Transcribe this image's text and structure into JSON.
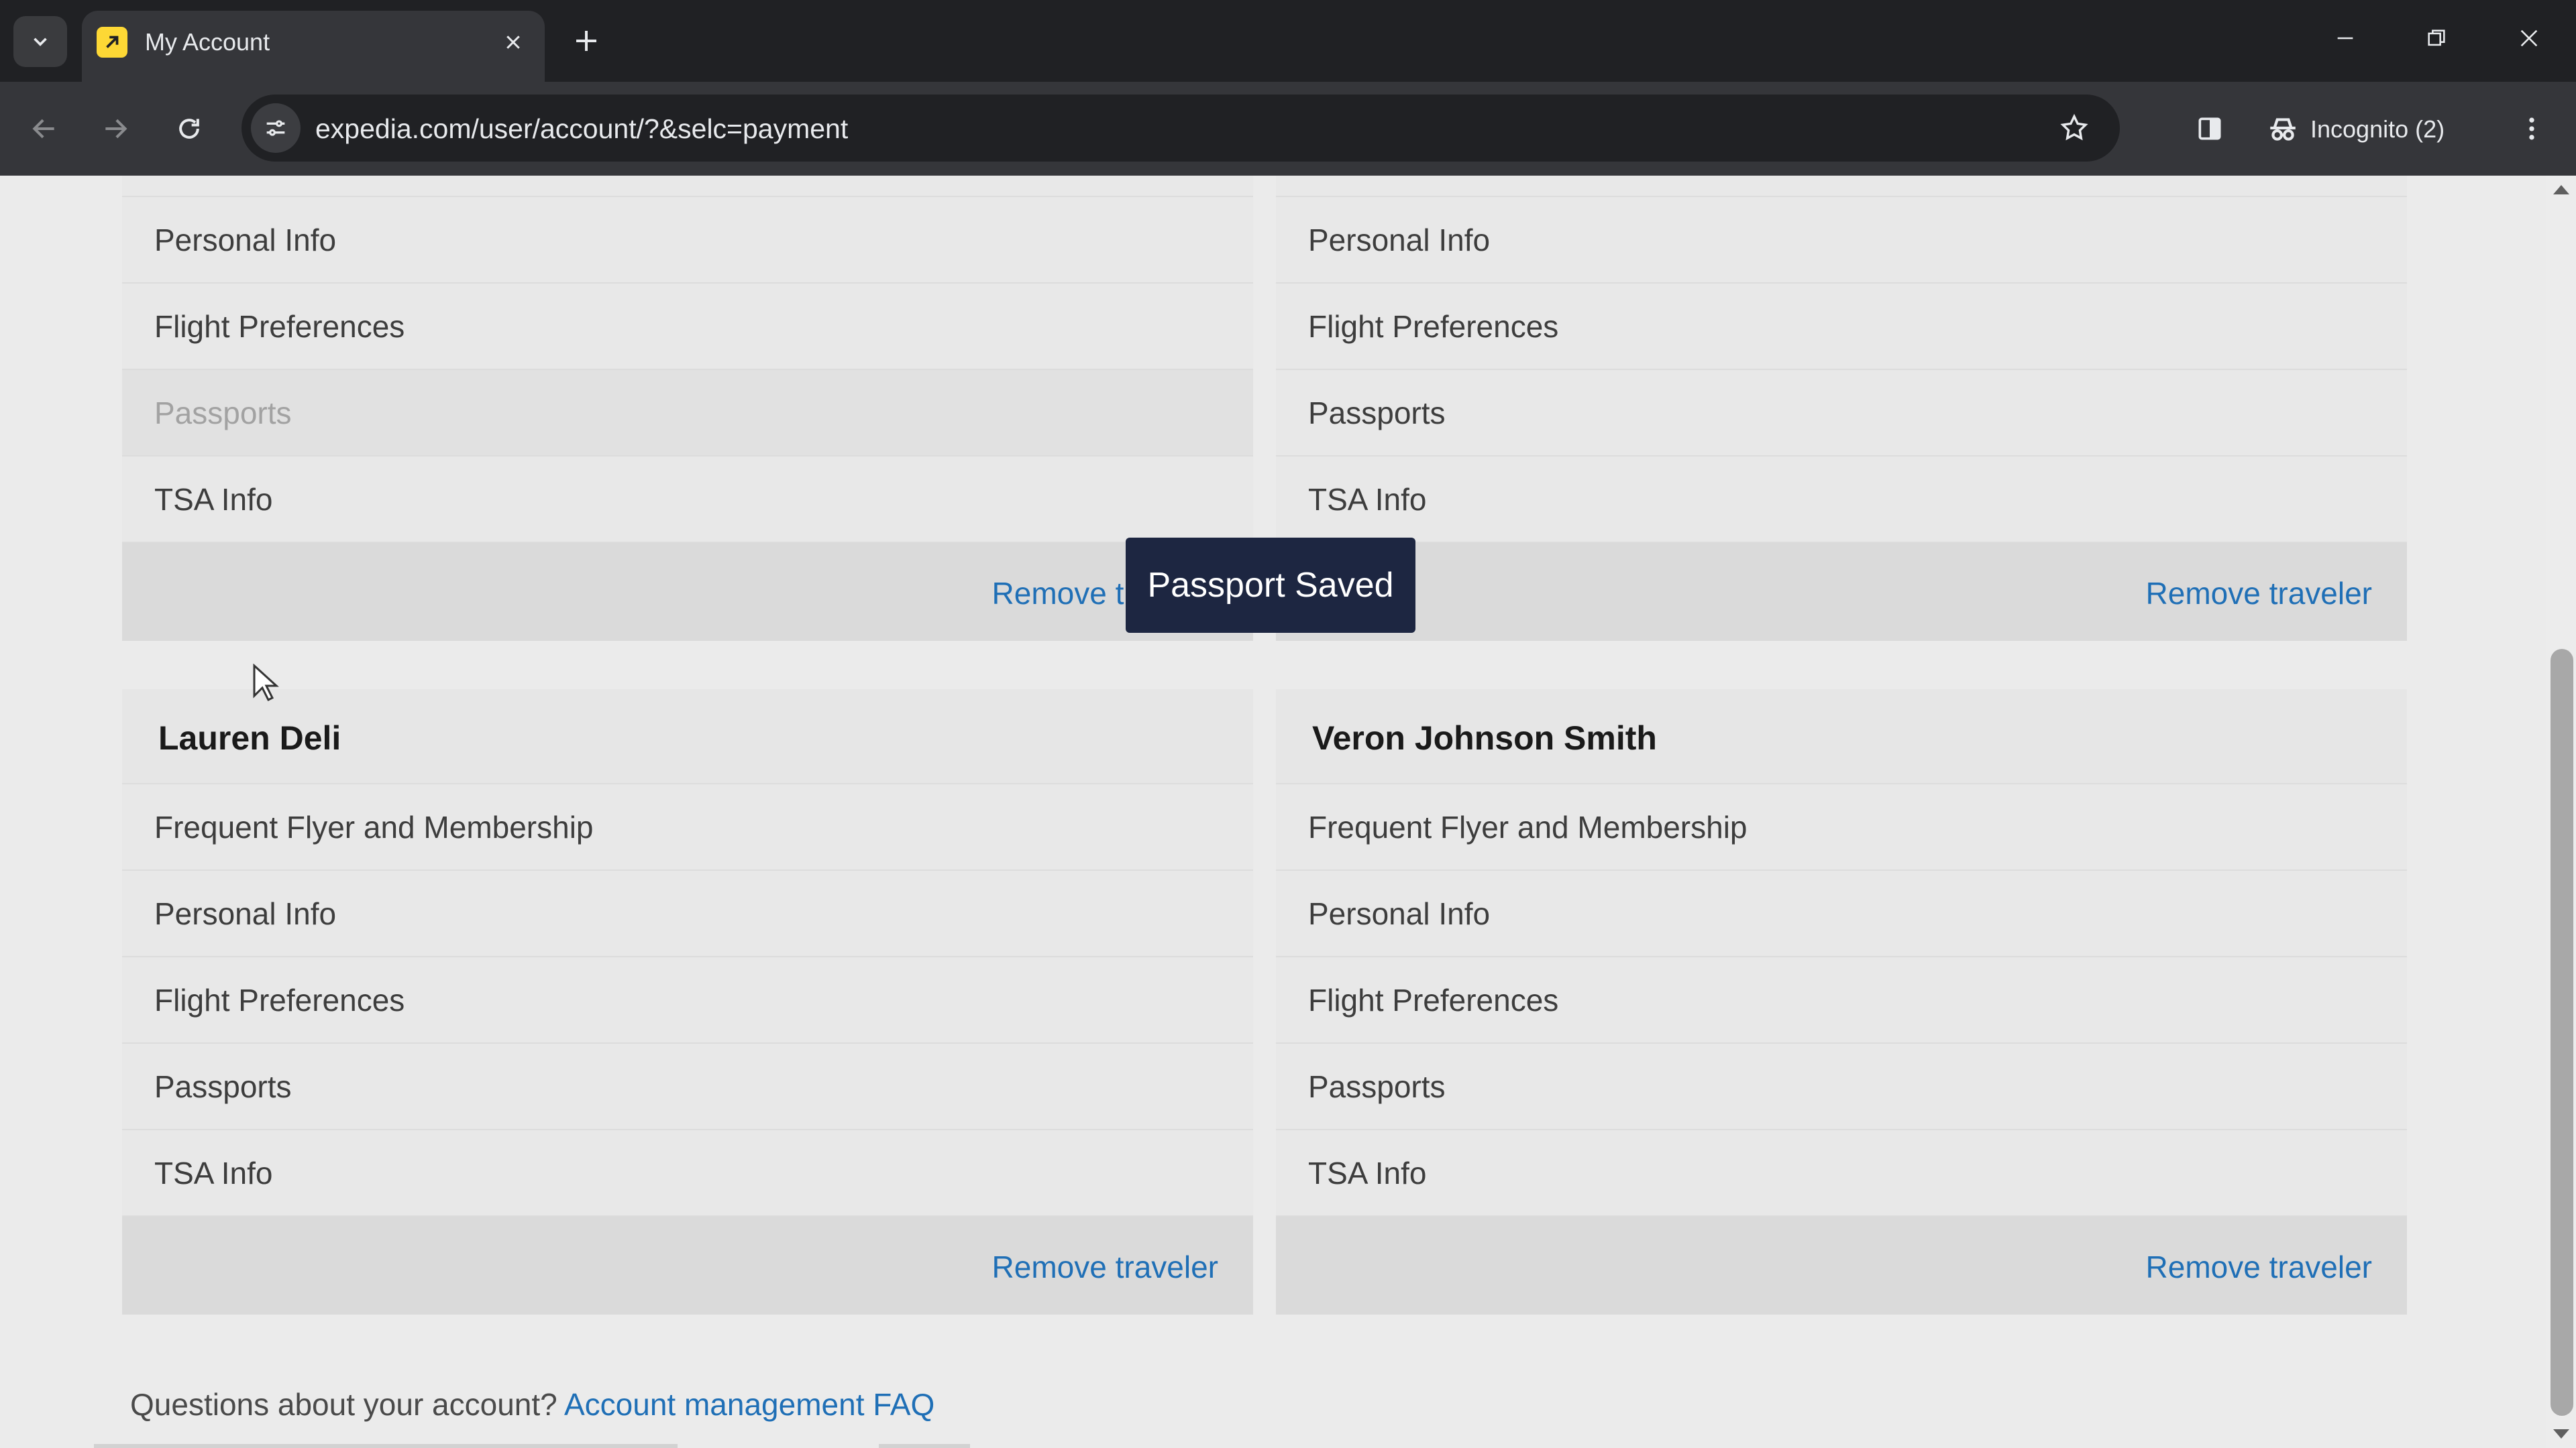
{
  "browser": {
    "tab_title": "My Account",
    "url": "expedia.com/user/account/?&selc=payment",
    "incognito_label": "Incognito (2)"
  },
  "top_cards": [
    {
      "rows": [
        "Personal Info",
        "Flight Preferences",
        "Passports",
        "TSA Info"
      ],
      "remove_label": "Remove traveler"
    },
    {
      "rows": [
        "Personal Info",
        "Flight Preferences",
        "Passports",
        "TSA Info"
      ],
      "remove_label": "Remove traveler"
    }
  ],
  "travelers": [
    {
      "name": "Lauren Deli",
      "rows": [
        "Frequent Flyer and Membership",
        "Personal Info",
        "Flight Preferences",
        "Passports",
        "TSA Info"
      ],
      "remove_label": "Remove traveler"
    },
    {
      "name": "Veron Johnson Smith",
      "rows": [
        "Frequent Flyer and Membership",
        "Personal Info",
        "Flight Preferences",
        "Passports",
        "TSA Info"
      ],
      "remove_label": "Remove traveler"
    }
  ],
  "toast": {
    "message": "Passport Saved"
  },
  "footer": {
    "question": "Questions about your account?",
    "faq_link": "Account management FAQ"
  },
  "colors": {
    "link": "#1f6fb6",
    "toast_bg": "#1d2641",
    "page_bg": "#ebebeb"
  }
}
